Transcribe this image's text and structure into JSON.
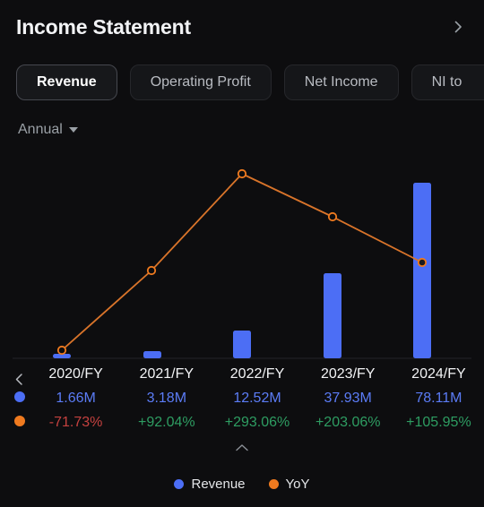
{
  "header": {
    "title": "Income Statement",
    "expand_icon": "chevron-right-icon"
  },
  "tabs": [
    {
      "label": "Revenue",
      "active": true
    },
    {
      "label": "Operating Profit",
      "active": false
    },
    {
      "label": "Net Income",
      "active": false
    },
    {
      "label": "NI to",
      "active": false
    }
  ],
  "period": {
    "label": "Annual",
    "caret": "chevron-down-icon"
  },
  "table": {
    "prev_icon": "chevron-left-icon",
    "collapse_icon": "chevron-up-icon",
    "columns": [
      {
        "year": "2020/FY",
        "revenue": "1.66M",
        "yoy": "-71.73%",
        "yoy_sign": "neg"
      },
      {
        "year": "2021/FY",
        "revenue": "3.18M",
        "yoy": "+92.04%",
        "yoy_sign": "pos"
      },
      {
        "year": "2022/FY",
        "revenue": "12.52M",
        "yoy": "+293.06%",
        "yoy_sign": "pos"
      },
      {
        "year": "2023/FY",
        "revenue": "37.93M",
        "yoy": "+203.06%",
        "yoy_sign": "pos"
      },
      {
        "year": "2024/FY",
        "revenue": "78.11M",
        "yoy": "+105.95%",
        "yoy_sign": "pos"
      }
    ]
  },
  "legend": [
    {
      "label": "Revenue",
      "color": "#4c6ef5"
    },
    {
      "label": "YoY",
      "color": "#ef7a1f"
    }
  ],
  "colors": {
    "background": "#0d0d0f",
    "bar": "#4c6ef5",
    "line": "#d9742a",
    "marker": "#ef7a1f",
    "positive": "#2e9d62",
    "negative": "#c4413f",
    "value_blue": "#5b7cf6",
    "muted_text": "#9aa0a6"
  },
  "chart_data": {
    "type": "bar",
    "title": "Income Statement — Revenue",
    "xlabel": "",
    "ylabel": "",
    "grid": false,
    "legend_position": "bottom",
    "categories": [
      "2020/FY",
      "2021/FY",
      "2022/FY",
      "2023/FY",
      "2024/FY"
    ],
    "series": [
      {
        "name": "Revenue",
        "type": "bar",
        "axis": "left",
        "unit": "M",
        "color": "#4c6ef5",
        "values": [
          1.66,
          3.18,
          12.52,
          37.93,
          78.11
        ],
        "labels": [
          "1.66M",
          "3.18M",
          "12.52M",
          "37.93M",
          "78.11M"
        ],
        "ylim": [
          0,
          80
        ]
      },
      {
        "name": "YoY",
        "type": "line",
        "axis": "right",
        "unit": "%",
        "color": "#ef7a1f",
        "values": [
          -71.73,
          92.04,
          293.06,
          203.06,
          105.95
        ],
        "labels": [
          "-71.73%",
          "+92.04%",
          "+293.06%",
          "+203.06%",
          "+105.95%"
        ],
        "ylim": [
          -80,
          300
        ]
      }
    ]
  }
}
